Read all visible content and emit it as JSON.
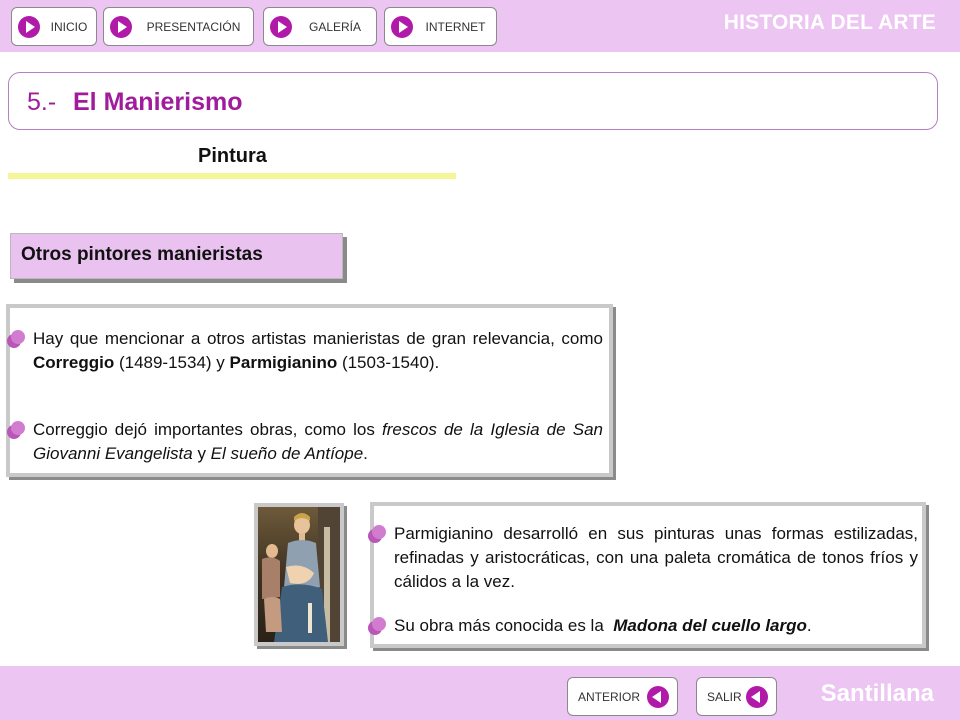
{
  "header": {
    "nav": [
      {
        "label": "INICIO",
        "icon": "play-arrow-icon"
      },
      {
        "label": "PRESENTACIÓN",
        "icon": "play-arrow-icon"
      },
      {
        "label": "GALERÍA",
        "icon": "play-arrow-icon"
      },
      {
        "label": "INTERNET",
        "icon": "play-arrow-icon"
      }
    ],
    "brand": "HISTORIA DEL ARTE"
  },
  "title": {
    "number": "5.-",
    "text": "El Manierismo"
  },
  "subtitle": "Pintura",
  "section_title": "Otros pintores manieristas",
  "panel1": {
    "b1": {
      "t1": "Hay que mencionar a otros artistas manieristas de gran relevancia, como ",
      "b1": "Correggio",
      "t2": " (1489-1534) y ",
      "b2": "Parmigianino",
      "t3": " (1503-1540)."
    },
    "b2": {
      "t1": "Correggio dejó importantes obras, como los ",
      "i1": "frescos de la Iglesia de San Giovanni Evangelista",
      "t2": " y ",
      "i2": "El sueño de Antíope",
      "t3": "."
    }
  },
  "panel2": {
    "b1": {
      "t1": "Parmigianino desarrolló en sus pinturas unas formas estilizadas, refinadas y aristocráticas, con una paleta cromática de tonos fríos y cálidos a la vez."
    },
    "b2": {
      "t1": "Su obra más conocida es la  ",
      "bi": "Madona del cuello largo",
      "t2": "."
    }
  },
  "footer": {
    "prev_label": "ANTERIOR",
    "exit_label": "SALIR",
    "publisher": "Santillana"
  },
  "colors": {
    "bar": "#ecc5f2",
    "accent": "#a01c9c",
    "arrow": "#b11aa8",
    "bullet": "#d27ccf",
    "underline": "#f5f59a"
  }
}
